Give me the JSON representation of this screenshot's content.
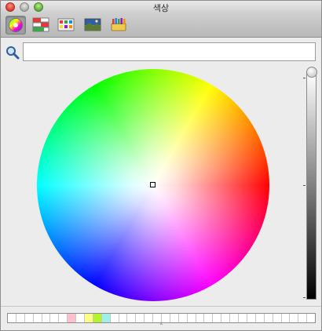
{
  "window": {
    "title": "색상"
  },
  "toolbar": {
    "tabs": [
      {
        "name": "color-wheel",
        "icon": "color-wheel-icon",
        "selected": true
      },
      {
        "name": "color-sliders",
        "icon": "color-sliders-icon",
        "selected": false
      },
      {
        "name": "color-palettes",
        "icon": "color-palettes-icon",
        "selected": false
      },
      {
        "name": "image-palettes",
        "icon": "image-palettes-icon",
        "selected": false
      },
      {
        "name": "crayons",
        "icon": "crayons-icon",
        "selected": false
      }
    ]
  },
  "search": {
    "value": "",
    "placeholder": ""
  },
  "brightness": {
    "value": 1.0
  },
  "swatches": [
    "#ffffff",
    "#ffffff",
    "#ffffff",
    "#ffffff",
    "#ffffff",
    "#ffffff",
    "#ffffff",
    "#ffc0cb",
    "#ffffff",
    "#ffff88",
    "#b4f52a",
    "#9ef0e8",
    "#ffffff",
    "#ffffff",
    "#ffffff",
    "#ffffff",
    "#ffffff",
    "#ffffff",
    "#ffffff",
    "#ffffff",
    "#ffffff",
    "#ffffff",
    "#ffffff",
    "#ffffff",
    "#ffffff",
    "#ffffff",
    "#ffffff",
    "#ffffff",
    "#ffffff",
    "#ffffff",
    "#ffffff",
    "#ffffff",
    "#ffffff",
    "#ffffff",
    "#ffffff",
    "#ffffff"
  ]
}
